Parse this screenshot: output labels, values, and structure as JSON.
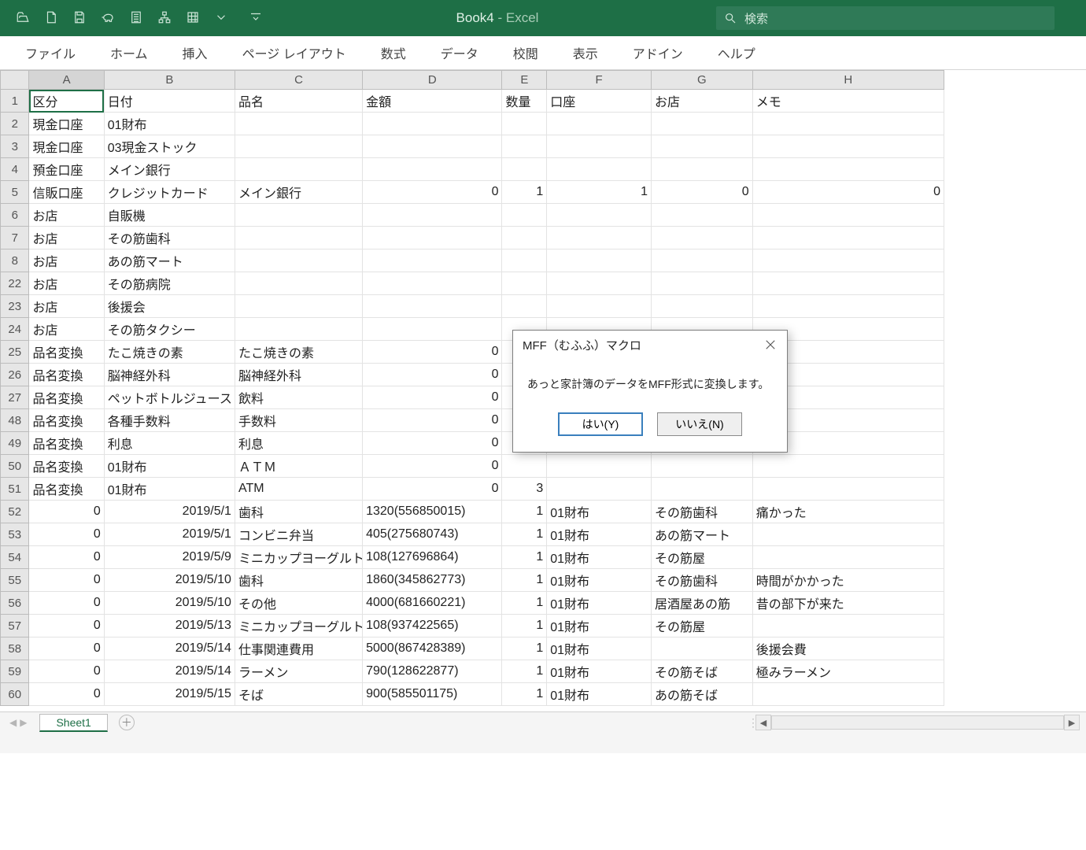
{
  "titlebar": {
    "book": "Book4",
    "app": "Excel",
    "search_placeholder": "検索"
  },
  "ribbon": [
    "ファイル",
    "ホーム",
    "挿入",
    "ページ レイアウト",
    "数式",
    "データ",
    "校閲",
    "表示",
    "アドイン",
    "ヘルプ"
  ],
  "columns": [
    "A",
    "B",
    "C",
    "D",
    "E",
    "F",
    "G",
    "H"
  ],
  "rows": [
    {
      "n": 1,
      "A": "区分",
      "B": "日付",
      "C": "品名",
      "D": "金額",
      "E": "数量",
      "F": "口座",
      "G": "お店",
      "H": "メモ"
    },
    {
      "n": 2,
      "A": "現金口座",
      "B": "01財布"
    },
    {
      "n": 3,
      "A": "現金口座",
      "B": "03現金ストック"
    },
    {
      "n": 4,
      "A": "預金口座",
      "B": "メイン銀行"
    },
    {
      "n": 5,
      "A": "信販口座",
      "B": "クレジットカード",
      "C": "メイン銀行",
      "D": "0",
      "Dnum": true,
      "E": "1",
      "Enum": true,
      "F": "1",
      "Fnum": true,
      "G": "0",
      "Gnum": true,
      "H": "0",
      "Hnum": true
    },
    {
      "n": 6,
      "A": "お店",
      "B": "自販機"
    },
    {
      "n": 7,
      "A": "お店",
      "B": "その筋歯科"
    },
    {
      "n": 8,
      "A": "お店",
      "B": "あの筋マート"
    },
    {
      "n": 22,
      "A": "お店",
      "B": "その筋病院"
    },
    {
      "n": 23,
      "A": "お店",
      "B": "後援会"
    },
    {
      "n": 24,
      "A": "お店",
      "B": "その筋タクシー"
    },
    {
      "n": 25,
      "A": "品名変換",
      "B": "たこ焼きの素",
      "C": "たこ焼きの素",
      "D": "0",
      "Dnum": true
    },
    {
      "n": 26,
      "A": "品名変換",
      "B": "脳神経外科",
      "C": "脳神経外科",
      "D": "0",
      "Dnum": true
    },
    {
      "n": 27,
      "A": "品名変換",
      "B": "ペットボトルジュース",
      "C": "飲料",
      "D": "0",
      "Dnum": true
    },
    {
      "n": 48,
      "A": "品名変換",
      "B": "各種手数料",
      "C": "手数料",
      "D": "0",
      "Dnum": true
    },
    {
      "n": 49,
      "A": "品名変換",
      "B": "利息",
      "C": "利息",
      "D": "0",
      "Dnum": true
    },
    {
      "n": 50,
      "A": "品名変換",
      "B": "01財布",
      "C": "ＡＴＭ",
      "D": "0",
      "Dnum": true
    },
    {
      "n": 51,
      "A": "品名変換",
      "B": "01財布",
      "C": "ATM",
      "D": "0",
      "Dnum": true,
      "E": "3",
      "Enum": true
    },
    {
      "n": 52,
      "A": "0",
      "Anum": true,
      "B": "2019/5/1",
      "Bnum": true,
      "C": "歯科",
      "D": "1320(556850015)",
      "E": "1",
      "Enum": true,
      "F": "01財布",
      "G": "その筋歯科",
      "H": "痛かった"
    },
    {
      "n": 53,
      "A": "0",
      "Anum": true,
      "B": "2019/5/1",
      "Bnum": true,
      "C": "コンビニ弁当",
      "D": "405(275680743)",
      "E": "1",
      "Enum": true,
      "F": "01財布",
      "G": "あの筋マート"
    },
    {
      "n": 54,
      "A": "0",
      "Anum": true,
      "B": "2019/5/9",
      "Bnum": true,
      "C": "ミニカップヨーグルト",
      "D": "108(127696864)",
      "E": "1",
      "Enum": true,
      "F": "01財布",
      "G": "その筋屋"
    },
    {
      "n": 55,
      "A": "0",
      "Anum": true,
      "B": "2019/5/10",
      "Bnum": true,
      "C": "歯科",
      "D": "1860(345862773)",
      "E": "1",
      "Enum": true,
      "F": "01財布",
      "G": "その筋歯科",
      "H": "時間がかかった"
    },
    {
      "n": 56,
      "A": "0",
      "Anum": true,
      "B": "2019/5/10",
      "Bnum": true,
      "C": "その他",
      "D": "4000(681660221)",
      "E": "1",
      "Enum": true,
      "F": "01財布",
      "G": "居酒屋あの筋",
      "H": "昔の部下が来た"
    },
    {
      "n": 57,
      "A": "0",
      "Anum": true,
      "B": "2019/5/13",
      "Bnum": true,
      "C": "ミニカップヨーグルト",
      "D": "108(937422565)",
      "E": "1",
      "Enum": true,
      "F": "01財布",
      "G": "その筋屋"
    },
    {
      "n": 58,
      "A": "0",
      "Anum": true,
      "B": "2019/5/14",
      "Bnum": true,
      "C": "仕事関連費用",
      "D": "5000(867428389)",
      "E": "1",
      "Enum": true,
      "F": "01財布",
      "H": "後援会費"
    },
    {
      "n": 59,
      "A": "0",
      "Anum": true,
      "B": "2019/5/14",
      "Bnum": true,
      "C": "ラーメン",
      "D": "790(128622877)",
      "E": "1",
      "Enum": true,
      "F": "01財布",
      "G": "その筋そば",
      "H": "極みラーメン"
    },
    {
      "n": 60,
      "A": "0",
      "Anum": true,
      "B": "2019/5/15",
      "Bnum": true,
      "C": "そば",
      "D": "900(585501175)",
      "E": "1",
      "Enum": true,
      "F": "01財布",
      "G": "あの筋そば"
    }
  ],
  "dialog": {
    "title": "MFF（むふふ）マクロ",
    "body": "あっと家計簿のデータをMFF形式に変換します。",
    "yes": "はい(Y)",
    "no": "いいえ(N)"
  },
  "sheet_tab": "Sheet1"
}
